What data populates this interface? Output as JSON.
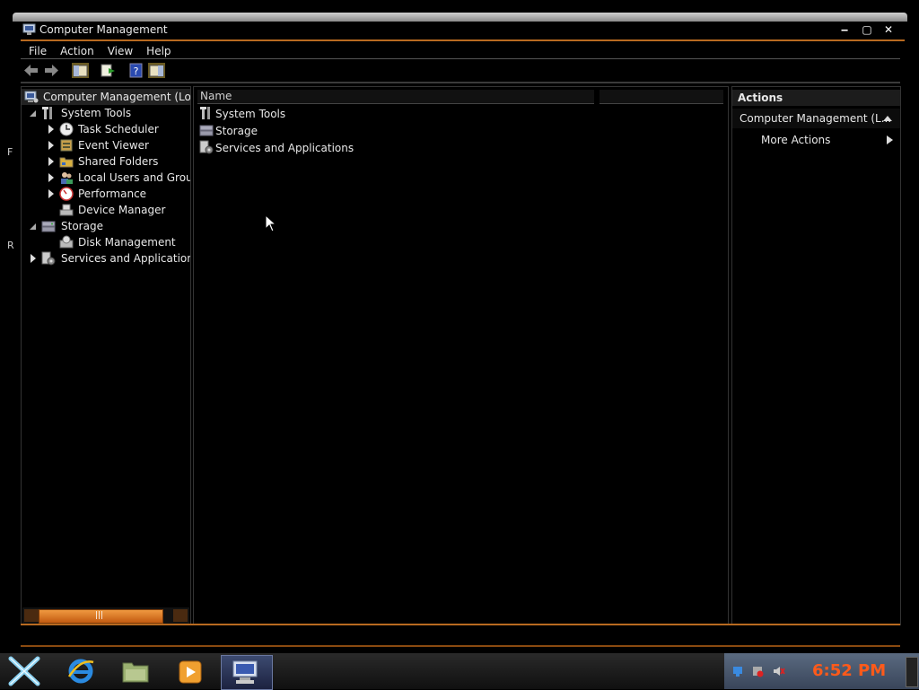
{
  "desktop": {
    "edge_letters": [
      "F",
      "R"
    ]
  },
  "window": {
    "title": "Computer Management",
    "controls": {
      "minimize": "‒",
      "maximize": "▢",
      "close": "✕"
    }
  },
  "menu": {
    "items": [
      "File",
      "Action",
      "View",
      "Help"
    ]
  },
  "toolbar": {
    "buttons": [
      "back-icon",
      "forward-icon",
      "show-hide-console-tree-icon",
      "export-list-icon",
      "help-icon",
      "show-hide-action-pane-icon"
    ]
  },
  "tree": {
    "root": "Computer Management (Local)",
    "items": [
      {
        "label": "System Tools",
        "level": 1,
        "state": "expanded",
        "icon": "tools-icon"
      },
      {
        "label": "Task Scheduler",
        "level": 2,
        "state": "collapsed",
        "icon": "clock-icon"
      },
      {
        "label": "Event Viewer",
        "level": 2,
        "state": "collapsed",
        "icon": "event-viewer-icon"
      },
      {
        "label": "Shared Folders",
        "level": 2,
        "state": "collapsed",
        "icon": "shared-folder-icon"
      },
      {
        "label": "Local Users and Groups",
        "level": 2,
        "state": "collapsed",
        "icon": "users-icon"
      },
      {
        "label": "Performance",
        "level": 2,
        "state": "collapsed",
        "icon": "performance-icon"
      },
      {
        "label": "Device Manager",
        "level": 2,
        "state": "leaf",
        "icon": "device-manager-icon"
      },
      {
        "label": "Storage",
        "level": 1,
        "state": "expanded",
        "icon": "storage-icon"
      },
      {
        "label": "Disk Management",
        "level": 2,
        "state": "leaf",
        "icon": "disk-icon"
      },
      {
        "label": "Services and Applications",
        "level": 1,
        "state": "collapsed",
        "icon": "services-icon"
      }
    ]
  },
  "list": {
    "columns": [
      "Name",
      ""
    ],
    "rows": [
      {
        "name": "System Tools",
        "icon": "tools-icon"
      },
      {
        "name": "Storage",
        "icon": "storage-icon"
      },
      {
        "name": "Services and Applications",
        "icon": "services-icon"
      }
    ]
  },
  "actions": {
    "header": "Actions",
    "section": "Computer Management (L...",
    "items": [
      "More Actions"
    ]
  },
  "taskbar": {
    "apps": [
      "start-icon",
      "internet-explorer-icon",
      "file-manager-icon",
      "media-player-icon",
      "computer-management-icon"
    ],
    "clock": "6:52 PM"
  },
  "colors": {
    "accent": "#b86a20",
    "clock": "#ff5a1a"
  }
}
